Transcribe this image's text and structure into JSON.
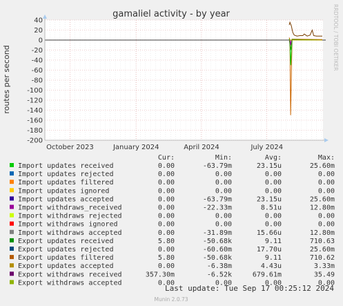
{
  "title": "gamaliel activity - by year",
  "side_label": "RRDTOOL / TOBI OETIKER",
  "footer": "Munin 2.0.73",
  "last_update": "Last update: Tue Sep 17 00:25:12 2024",
  "colors": {
    "background": "#f0f0f0",
    "plot_bg": "#ffffff",
    "grid_major": "#e4a0a0",
    "grid_minor": "#dcdcdc",
    "axis": "#000000",
    "text": "#333333"
  },
  "chart_data": {
    "type": "line",
    "ylabel": "routes per second",
    "xlabel": "",
    "ylim": [
      -200,
      40
    ],
    "yticks": [
      40,
      20,
      0,
      -20,
      -40,
      -60,
      -80,
      -100,
      -120,
      -140,
      -160,
      -180,
      -200
    ],
    "x_range": [
      "2023-08-27",
      "2024-09-17"
    ],
    "xticks": [
      {
        "label": "October 2023",
        "date": "2023-10-01"
      },
      {
        "label": "January 2024",
        "date": "2024-01-01"
      },
      {
        "label": "April 2024",
        "date": "2024-04-01"
      },
      {
        "label": "July 2024",
        "date": "2024-07-01"
      }
    ],
    "series": [
      {
        "name": "Export withdraws received",
        "color": "#7a3d00",
        "x": [
          "2024-08-01",
          "2024-08-02",
          "2024-08-04",
          "2024-08-06",
          "2024-08-08",
          "2024-08-12",
          "2024-08-16",
          "2024-08-20",
          "2024-08-22",
          "2024-08-26",
          "2024-08-30",
          "2024-09-02",
          "2024-09-04",
          "2024-09-08",
          "2024-09-12",
          "2024-09-16"
        ],
        "values": [
          30,
          35.49,
          28,
          15,
          10,
          8,
          9,
          9,
          12,
          8,
          10,
          20,
          9,
          8,
          8,
          8
        ]
      },
      {
        "name": "Export updates filtered",
        "color": "#cc6600",
        "x": [
          "2024-08-01",
          "2024-08-02",
          "2024-08-03",
          "2024-08-05",
          "2024-09-16"
        ],
        "values": [
          5,
          0,
          -150,
          2,
          1
        ]
      },
      {
        "name": "Export updates received",
        "color": "#00cc00",
        "x": [
          "2024-08-01",
          "2024-08-02",
          "2024-08-03",
          "2024-08-05",
          "2024-09-16"
        ],
        "values": [
          2,
          0,
          -50,
          1,
          0
        ]
      },
      {
        "name": "Import updates received",
        "color": "#2b8f00",
        "x": [
          "2024-08-01",
          "2024-08-03",
          "2024-08-05",
          "2024-09-16"
        ],
        "values": [
          2,
          -20,
          1,
          0
        ]
      },
      {
        "name": "Import withdraws_received",
        "color": "#990099",
        "x": [
          "2024-08-02",
          "2024-08-03",
          "2024-08-04"
        ],
        "values": [
          0,
          -10,
          0
        ]
      },
      {
        "name": "Export updates accepted",
        "color": "#b8a000",
        "x": [
          "2024-08-01",
          "2024-09-16"
        ],
        "values": [
          0,
          0
        ]
      }
    ]
  },
  "legend_header": [
    "Cur:",
    "Min:",
    "Avg:",
    "Max:"
  ],
  "legend": [
    {
      "color": "#00cc00",
      "name": "Import updates received",
      "cur": "0.00",
      "min": "-63.79m",
      "avg": "23.15u",
      "max": "25.60m"
    },
    {
      "color": "#0066b3",
      "name": "Import updates rejected",
      "cur": "0.00",
      "min": "0.00",
      "avg": "0.00",
      "max": "0.00"
    },
    {
      "color": "#ff8000",
      "name": "Import updates filtered",
      "cur": "0.00",
      "min": "0.00",
      "avg": "0.00",
      "max": "0.00"
    },
    {
      "color": "#ffcc00",
      "name": "Import updates ignored",
      "cur": "0.00",
      "min": "0.00",
      "avg": "0.00",
      "max": "0.00"
    },
    {
      "color": "#330099",
      "name": "Import updates accepted",
      "cur": "0.00",
      "min": "-63.79m",
      "avg": "23.15u",
      "max": "25.60m"
    },
    {
      "color": "#990099",
      "name": "Import withdraws_received",
      "cur": "0.00",
      "min": "-22.33m",
      "avg": "8.51u",
      "max": "12.80m"
    },
    {
      "color": "#ccff00",
      "name": "Import withdraws rejected",
      "cur": "0.00",
      "min": "0.00",
      "avg": "0.00",
      "max": "0.00"
    },
    {
      "color": "#ff0000",
      "name": "Import withdraws ignored",
      "cur": "0.00",
      "min": "0.00",
      "avg": "0.00",
      "max": "0.00"
    },
    {
      "color": "#808080",
      "name": "Import withdraws accepted",
      "cur": "0.00",
      "min": "-31.89m",
      "avg": "15.66u",
      "max": "12.80m"
    },
    {
      "color": "#008f00",
      "name": "Export updates received",
      "cur": "5.80",
      "min": "-50.68k",
      "avg": "9.11",
      "max": "710.63"
    },
    {
      "color": "#00487d",
      "name": "Export updates rejected",
      "cur": "0.00",
      "min": "-60.60m",
      "avg": "17.70u",
      "max": "25.60m"
    },
    {
      "color": "#b35a00",
      "name": "Export updates filtered",
      "cur": "5.80",
      "min": "-50.68k",
      "avg": "9.11",
      "max": "710.62"
    },
    {
      "color": "#b38f00",
      "name": "Export updates accepted",
      "cur": "0.00",
      "min": "-6.38m",
      "avg": "4.43u",
      "max": "3.33m"
    },
    {
      "color": "#6b006b",
      "name": "Export withdraws received",
      "cur": "357.30m",
      "min": "-6.52k",
      "avg": "679.61m",
      "max": "35.49"
    },
    {
      "color": "#8fb300",
      "name": "Export withdraws accepted",
      "cur": "0.00",
      "min": "0.00",
      "avg": "0.00",
      "max": "0.00"
    }
  ]
}
